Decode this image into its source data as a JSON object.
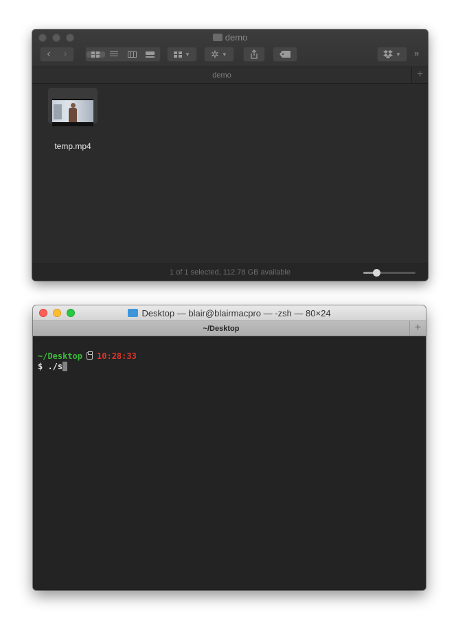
{
  "finder": {
    "title": "demo",
    "pathbar_label": "demo",
    "pathbar_add": "+",
    "toolbar_overflow": "»",
    "file": {
      "name": "temp.mp4"
    },
    "status": "1 of 1 selected, 112.78 GB available",
    "icon_zoom": 0.25
  },
  "terminal": {
    "title": "Desktop — blair@blairmacpro — -zsh — 80×24",
    "tab_label": "~/Desktop",
    "tab_add": "+",
    "prompt_dir": "~/Desktop",
    "prompt_time": "10:28:33",
    "prompt_symbol": "$",
    "command": "./s"
  }
}
